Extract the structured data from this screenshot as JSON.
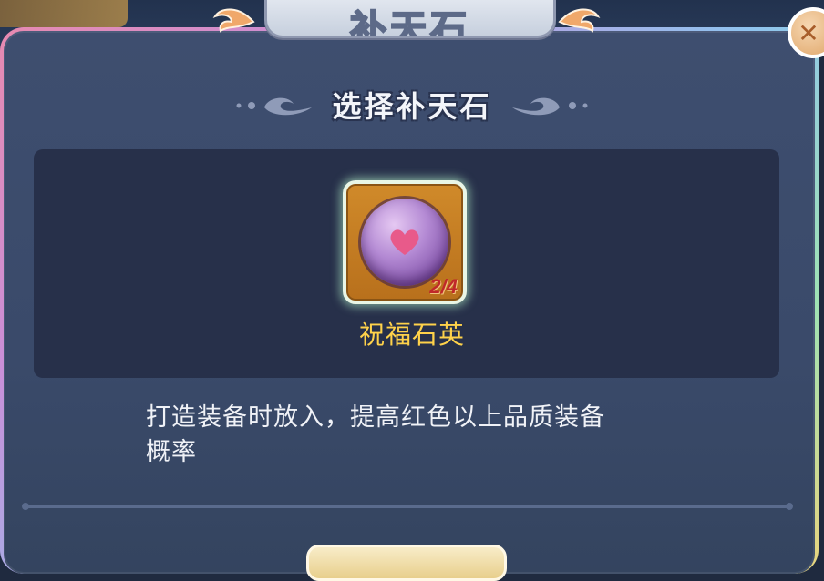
{
  "window": {
    "title": "补天石",
    "close_icon": "close-icon"
  },
  "section": {
    "title": "选择补天石"
  },
  "item": {
    "name": "祝福石英",
    "count": "2/4",
    "icon": "heart-orb-icon"
  },
  "description": {
    "line1": "打造装备时放入，提高红色以上品质装备",
    "line2": "概率"
  },
  "colors": {
    "item_name": "#ffd24a",
    "count": "#c0282a",
    "panel": "#3e4e6f",
    "item_box": "#27304a"
  }
}
